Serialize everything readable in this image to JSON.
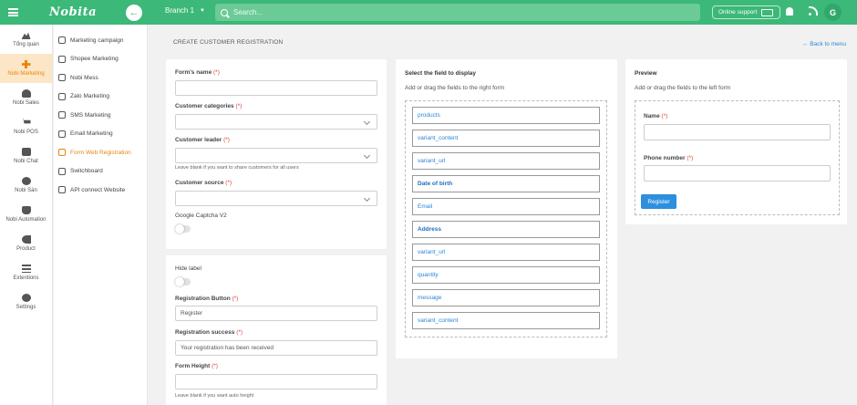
{
  "header": {
    "logo": "Nobita",
    "branch": "Branch 1",
    "search_placeholder": "Search...",
    "online_support": "Online support",
    "avatar_initial": "G"
  },
  "sidebar": {
    "items": [
      {
        "label": "Tổng quan",
        "icon": "dashboard-icon"
      },
      {
        "label": "Nobi Marketing",
        "icon": "marketing-icon",
        "active": true
      },
      {
        "label": "Nobi Sales",
        "icon": "headset-icon"
      },
      {
        "label": "Nobi POS",
        "icon": "cart-icon"
      },
      {
        "label": "Nobi Chat",
        "icon": "chat-icon"
      },
      {
        "label": "Nobi Sàn",
        "icon": "users-icon"
      },
      {
        "label": "Nobi Automation",
        "icon": "robot-icon"
      },
      {
        "label": "Product",
        "icon": "product-icon"
      },
      {
        "label": "Extentions",
        "icon": "list-icon"
      },
      {
        "label": "Settings",
        "icon": "gear-icon"
      }
    ]
  },
  "submenu": {
    "items": [
      {
        "label": "Marketing campaign",
        "icon": "campaign-icon"
      },
      {
        "label": "Shopee Marketing",
        "icon": "shopee-icon"
      },
      {
        "label": "Nobi Mess",
        "icon": "facebook-icon"
      },
      {
        "label": "Zalo Marketing",
        "icon": "zalo-icon"
      },
      {
        "label": "SMS Marketing",
        "icon": "sms-icon"
      },
      {
        "label": "Email Marketing",
        "icon": "email-icon"
      },
      {
        "label": "Form Web Registration",
        "icon": "form-icon",
        "active": true
      },
      {
        "label": "Switchboard",
        "icon": "switchboard-icon"
      },
      {
        "label": "API connect Website",
        "icon": "key-icon"
      }
    ]
  },
  "page": {
    "title": "CREATE CUSTOMER REGISTRATION",
    "back_to_menu": "Back to menu"
  },
  "form_settings": {
    "form_name_label": "Form's name",
    "form_name_value": "",
    "customer_categories_label": "Customer categories",
    "customer_leader_label": "Customer leader",
    "customer_leader_hint": "Leave blank if you want to share customers for all users",
    "customer_source_label": "Customer source",
    "captcha_label": "Google Captcha V2",
    "required_mark": "(*)"
  },
  "form_options": {
    "hide_label": "Hide label",
    "registration_button_label": "Registration Button",
    "registration_button_value": "Register",
    "registration_success_label": "Registration success",
    "registration_success_value": "Your registration has been received",
    "form_height_label": "Form Height",
    "form_height_hint": "Leave blank if you want auto height"
  },
  "field_selector": {
    "title": "Select the field to display",
    "subtitle": "Add or drag the fields to the right form",
    "fields": [
      {
        "label": "products",
        "bold": false
      },
      {
        "label": "variant_content",
        "bold": false
      },
      {
        "label": "variant_url",
        "bold": false
      },
      {
        "label": "Date of birth",
        "bold": true
      },
      {
        "label": "Email",
        "bold": false
      },
      {
        "label": "Address",
        "bold": true
      },
      {
        "label": "variant_url",
        "bold": false
      },
      {
        "label": "quantity",
        "bold": false
      },
      {
        "label": "message",
        "bold": false
      },
      {
        "label": "variant_content",
        "bold": false
      }
    ]
  },
  "preview": {
    "title": "Preview",
    "subtitle": "Add or drag the fields to the left form",
    "name_label": "Name",
    "phone_label": "Phone number",
    "register_button": "Register"
  },
  "colors": {
    "brand_green": "#3cb878",
    "active_orange": "#e8850f",
    "link_blue": "#2a86d7",
    "button_blue": "#2d8fdd",
    "required_red": "#e04040"
  }
}
